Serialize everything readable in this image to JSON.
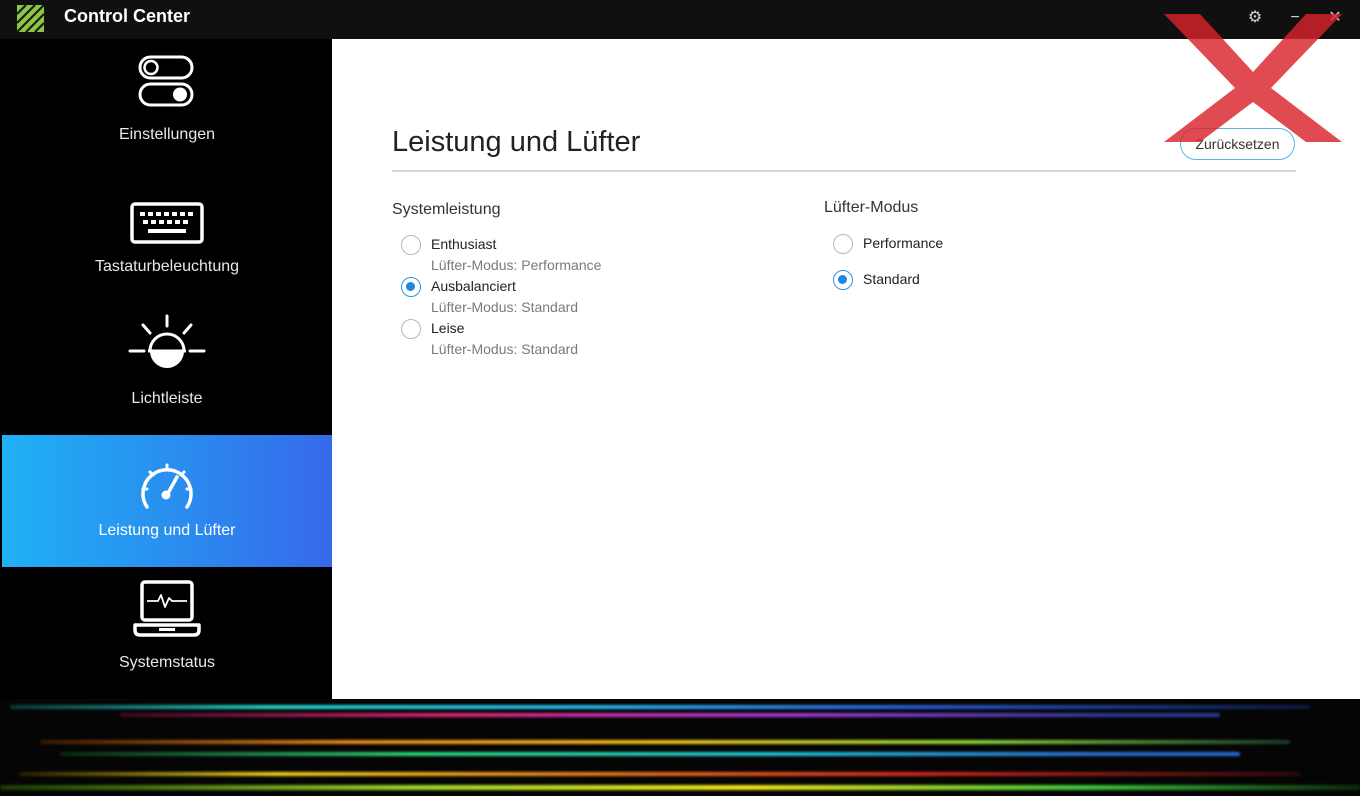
{
  "window": {
    "title": "Control Center",
    "controls": {
      "settings": "⚙",
      "minimize": "−",
      "close": "✕"
    }
  },
  "sidebar": {
    "items": [
      {
        "label": "Einstellungen",
        "icon": "toggle-switches-icon",
        "active": false
      },
      {
        "label": "Tastaturbeleuchtung",
        "icon": "keyboard-icon",
        "active": false
      },
      {
        "label": "Lichtleiste",
        "icon": "light-bar-icon",
        "active": false
      },
      {
        "label": "Leistung und Lüfter",
        "icon": "speedometer-icon",
        "active": true
      },
      {
        "label": "Systemstatus",
        "icon": "laptop-monitor-icon",
        "active": false
      }
    ]
  },
  "main": {
    "title": "Leistung und Lüfter",
    "reset_label": "Zurücksetzen",
    "systemleistung": {
      "title": "Systemleistung",
      "options": [
        {
          "label": "Enthusiast",
          "sub": "Lüfter-Modus: Performance",
          "checked": false
        },
        {
          "label": "Ausbalanciert",
          "sub": "Lüfter-Modus: Standard",
          "checked": true
        },
        {
          "label": "Leise",
          "sub": "Lüfter-Modus: Standard",
          "checked": false
        }
      ]
    },
    "luefter": {
      "title": "Lüfter-Modus",
      "options": [
        {
          "label": "Performance",
          "checked": false
        },
        {
          "label": "Standard",
          "checked": true
        }
      ]
    }
  },
  "colors": {
    "accent": "#1f87e0",
    "active_gradient_start": "#1fb1f5",
    "active_gradient_end": "#3569ea",
    "logo_green": "#8dc63f",
    "watermark_red": "#d8232a"
  }
}
